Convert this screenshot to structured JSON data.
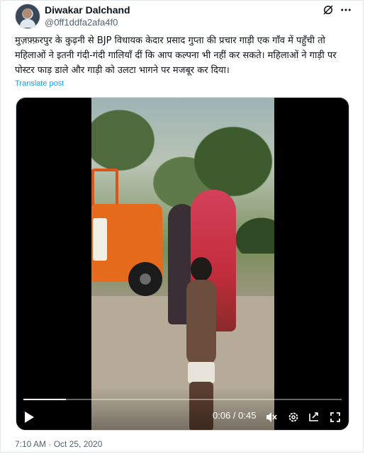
{
  "author": {
    "name": "Diwakar Dalchand",
    "handle": "@0ff1ddfa2afa4f0"
  },
  "tweet": {
    "text": "मुज़फ़्फ़रपुर के कुढ़नी से BJP विधायक केदार प्रसाद गुप्ता की प्रचार गाड़ी एक गाँव में पहुँची तो महिलाओं ने इतनी गंदी-गंदी गालियाँ दीं कि आप कल्पना भी नहीं कर सकते। महिलाओं ने गाड़ी पर पोस्टर फाड़ डाले और गाड़ी को उलटा भागने पर मजबूर कर दिया।",
    "translate_label": "Translate post",
    "timestamp": "7:10 AM · Oct 25, 2020"
  },
  "video": {
    "current_time": "0:06",
    "duration": "0:45",
    "time_display": "0:06 / 0:45",
    "progress_fraction": 0.133
  },
  "icons": {
    "grok": "grok-icon",
    "more": "more-icon",
    "play": "play-icon",
    "volume": "volume-icon",
    "settings": "gear-icon",
    "pip": "pip-icon",
    "fullscreen": "fullscreen-icon"
  },
  "colors": {
    "link": "#1d9bf0",
    "secondary_text": "#536471",
    "primary_text": "#0f1419"
  }
}
